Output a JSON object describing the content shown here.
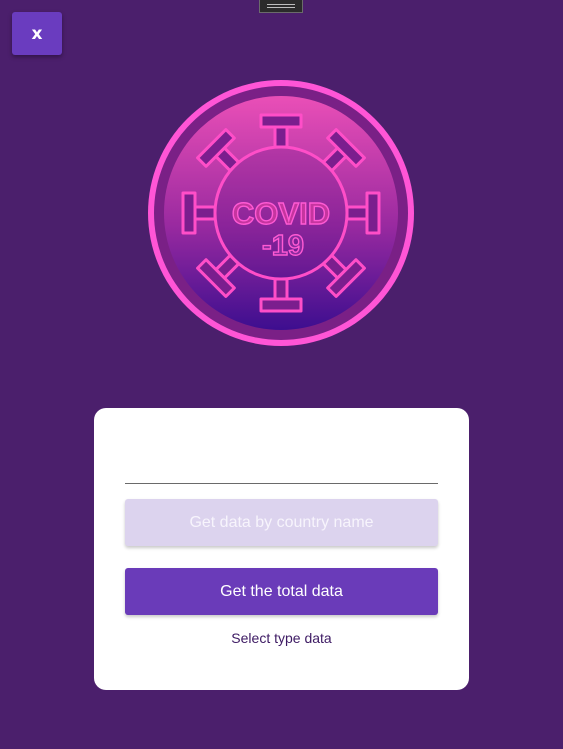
{
  "window": {
    "close_label": "x"
  },
  "logo": {
    "line1": "COVID",
    "line2": "-19",
    "colors": {
      "ring": "#ff55d6",
      "gradient_top": "#ea4fb7",
      "gradient_bottom": "#3d0e8f",
      "stroke": "#ff4ec8"
    }
  },
  "form": {
    "country_input_value": "",
    "country_button_label": "Get data by country name",
    "total_button_label": "Get the total data",
    "helper_text": "Select type data"
  },
  "theme": {
    "background": "#4b1f6c",
    "accent": "#6a3bb9",
    "disabled_button": "#dcd3ee"
  }
}
